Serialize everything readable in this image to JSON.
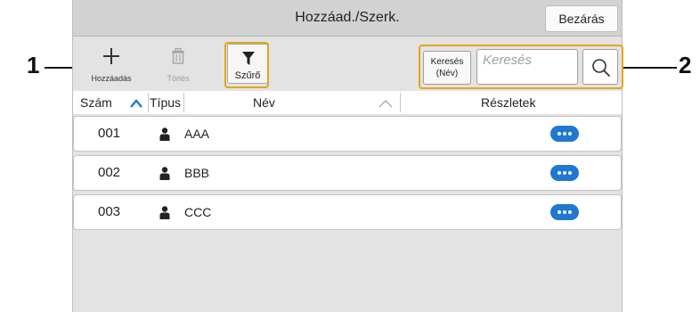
{
  "window": {
    "title": "Hozzáad./Szerk.",
    "close_label": "Bezárás"
  },
  "toolbar": {
    "add_label": "Hozzáadás",
    "delete_label": "Törlés",
    "filter_label": "Szűrő"
  },
  "search": {
    "type_label_line1": "Keresés",
    "type_label_line2": "(Név)",
    "placeholder": "Keresés"
  },
  "columns": {
    "number": "Szám",
    "type": "Típus",
    "name": "Név",
    "details": "Részletek"
  },
  "rows": [
    {
      "number": "001",
      "name": "AAA"
    },
    {
      "number": "002",
      "name": "BBB"
    },
    {
      "number": "003",
      "name": "CCC"
    }
  ],
  "callouts": {
    "one": "1",
    "two": "2"
  },
  "colors": {
    "accent": "#1f78d1",
    "highlight": "#e3a51b",
    "panel": "#e3e3e3"
  },
  "icons": [
    "plus-icon",
    "trash-icon",
    "filter-icon",
    "search-icon",
    "sort-asc-icon",
    "person-icon",
    "more-icon"
  ]
}
